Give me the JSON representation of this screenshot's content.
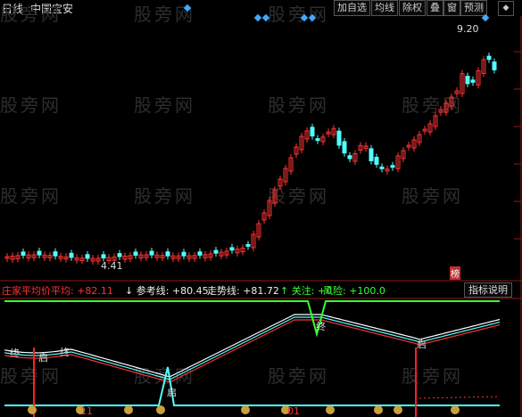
{
  "header": {
    "period": "日线",
    "stock_name": "中国宝安",
    "buttons": [
      "加自选",
      "均线",
      "除权",
      "叠",
      "窗",
      "预测"
    ]
  },
  "watermark": "股旁网",
  "price_labels": {
    "high": "9.20",
    "low": "4.41"
  },
  "markers": {
    "top_right": "榜"
  },
  "indicator": {
    "items": [
      {
        "label": "庄家平均价平均",
        "value": "+82.11",
        "color": "#ff3333"
      },
      {
        "label": "参考线",
        "value": "+80.45",
        "color": "#ffffff"
      },
      {
        "label": "走势线",
        "value": "+81.72",
        "color": "#ffffff"
      },
      {
        "label": "关注",
        "value": "+0",
        "color": "#33ff33"
      },
      {
        "label": "风险",
        "value": "+100.0",
        "color": "#33ff33"
      }
    ],
    "help_button": "指标说明",
    "signals": [
      "终",
      "启",
      "终",
      "启",
      "终",
      "启"
    ]
  },
  "date_labels": [
    "11",
    "01"
  ],
  "colors": {
    "up": "#ff3232",
    "down": "#54ffff",
    "bg": "#000000"
  }
}
